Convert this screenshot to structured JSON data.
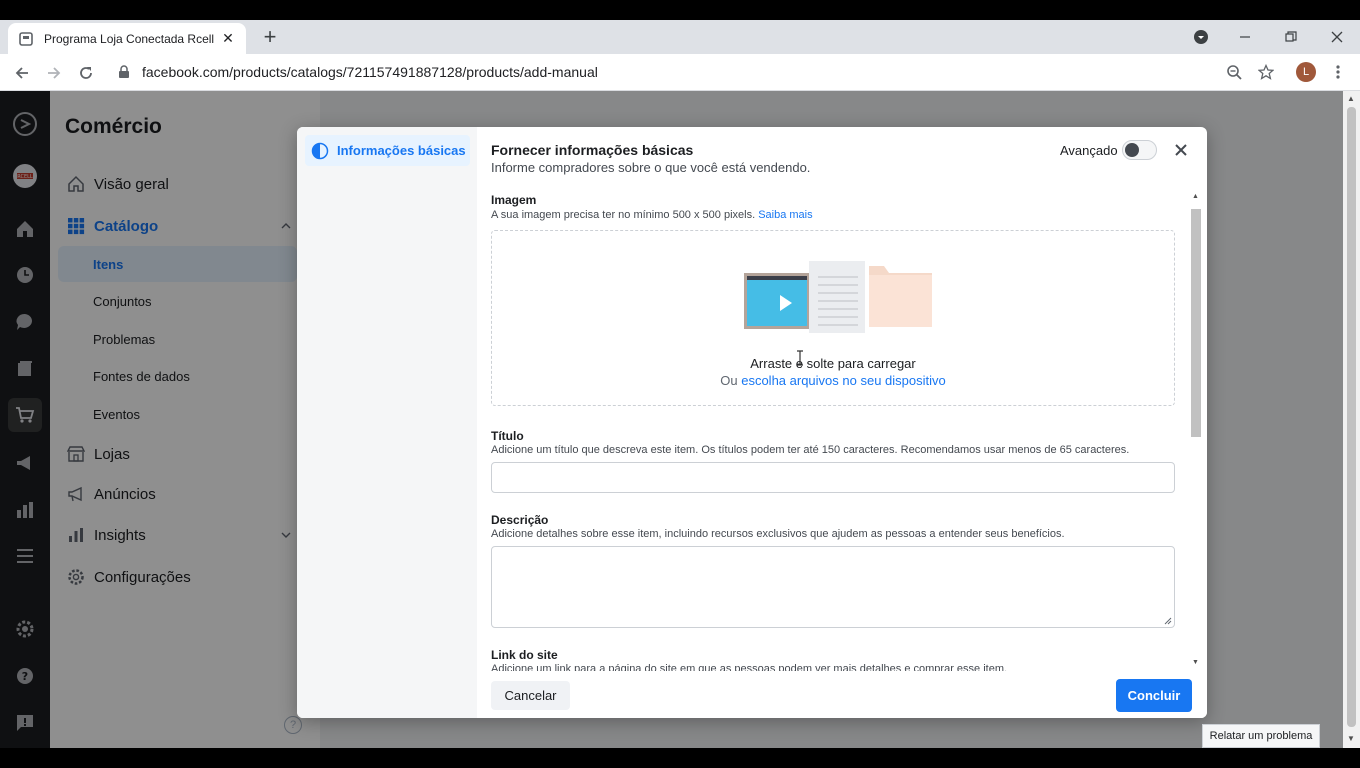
{
  "browser": {
    "tab_title": "Programa Loja Conectada Rcell",
    "tab_close": "✕",
    "new_tab": "+",
    "url": "facebook.com/products/catalogs/721157491887128/products/add-manual",
    "profile_initial": "L"
  },
  "sidebar": {
    "title": "Comércio",
    "items": [
      {
        "label": "Visão geral",
        "icon": "home-icon"
      },
      {
        "label": "Catálogo",
        "icon": "grid-icon"
      },
      {
        "label": "Lojas",
        "icon": "store-icon"
      },
      {
        "label": "Anúncios",
        "icon": "megaphone-icon"
      },
      {
        "label": "Insights",
        "icon": "bar-chart-icon"
      },
      {
        "label": "Configurações",
        "icon": "gear-icon"
      }
    ],
    "catalog_sub": [
      "Itens",
      "Conjuntos",
      "Problemas",
      "Fontes de dados",
      "Eventos"
    ],
    "help": "?"
  },
  "dialog": {
    "step_label": "Informações básicas",
    "title": "Fornecer informações básicas",
    "subtitle": "Informe compradores sobre o que você está vendendo.",
    "advanced_label": "Avançado",
    "image": {
      "label": "Imagem",
      "help": "A sua imagem precisa ter no mínimo 500 x 500 pixels.",
      "help_link": "Saiba mais",
      "drop_text": "Arraste e solte para carregar",
      "or": "Ou",
      "choose_link": "escolha arquivos no seu dispositivo"
    },
    "title_field": {
      "label": "Título",
      "help": "Adicione um título que descreva este item. Os títulos podem ter até 150 caracteres. Recomendamos usar menos de 65 caracteres.",
      "value": ""
    },
    "description_field": {
      "label": "Descrição",
      "help": "Adicione detalhes sobre esse item, incluindo recursos exclusivos que ajudem as pessoas a entender seus benefícios.",
      "value": ""
    },
    "link_field": {
      "label": "Link do site",
      "help": "Adicione um link para a página do site em que as pessoas podem ver mais detalhes e comprar esse item."
    },
    "cancel": "Cancelar",
    "done": "Concluir"
  },
  "report_problem": "Relatar um problema",
  "colors": {
    "accent": "#1877f2",
    "rail": "#1c1e21"
  }
}
